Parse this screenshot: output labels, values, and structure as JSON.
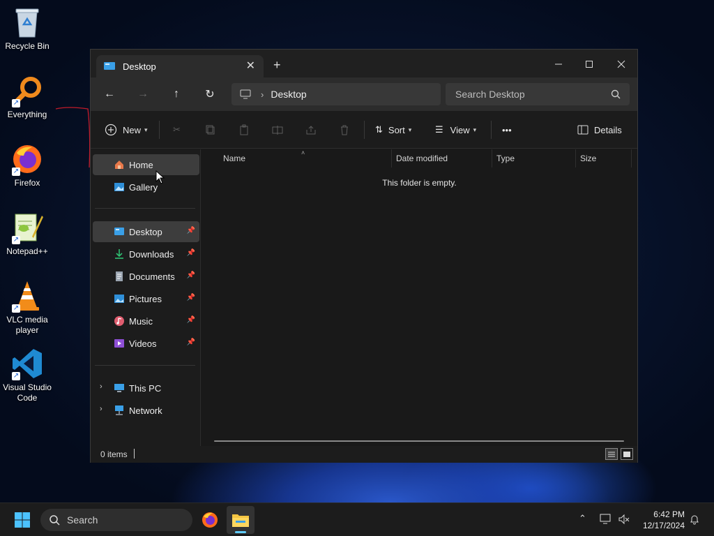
{
  "desktop": {
    "icons": [
      {
        "label": "Recycle Bin"
      },
      {
        "label": "Everything"
      },
      {
        "label": "Firefox"
      },
      {
        "label": "Notepad++"
      },
      {
        "label": "VLC media player"
      },
      {
        "label": "Visual Studio Code"
      }
    ]
  },
  "window": {
    "tab_title": "Desktop",
    "address": {
      "crumb": "Desktop"
    },
    "search_placeholder": "Search Desktop",
    "toolbar": {
      "new_label": "New",
      "sort_label": "Sort",
      "view_label": "View",
      "more_label": "•••",
      "details_label": "Details"
    },
    "sidebar": {
      "top": [
        {
          "label": "Home"
        },
        {
          "label": "Gallery"
        }
      ],
      "quick_access": [
        {
          "label": "Desktop"
        },
        {
          "label": "Downloads"
        },
        {
          "label": "Documents"
        },
        {
          "label": "Pictures"
        },
        {
          "label": "Music"
        },
        {
          "label": "Videos"
        }
      ],
      "bottom": [
        {
          "label": "This PC"
        },
        {
          "label": "Network"
        }
      ]
    },
    "columns": [
      "Name",
      "Date modified",
      "Type",
      "Size"
    ],
    "empty_message": "This folder is empty.",
    "status": "0 items"
  },
  "taskbar": {
    "search_label": "Search",
    "time": "6:42 PM",
    "date": "12/17/2024"
  },
  "colors": {
    "accent": "#60cdff",
    "window_bg": "#191919",
    "folder_yellow": "#f4c542"
  }
}
